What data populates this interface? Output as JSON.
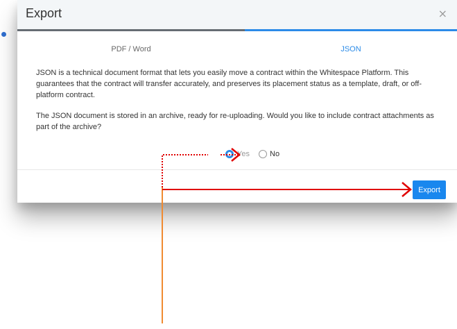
{
  "dialog": {
    "title": "Export",
    "close_glyph": "×"
  },
  "tabs": [
    {
      "label": "PDF / Word",
      "active": false
    },
    {
      "label": "JSON",
      "active": true
    }
  ],
  "body": {
    "paragraph_1": "JSON is a technical document format that lets you easily move a contract within the Whitespace Platform. This guarantees that the contract will transfer accurately, and preserves its placement status as a template, draft, or off-platform contract.",
    "paragraph_2": "The JSON document is stored in an archive, ready for re-uploading. Would you like to include contract attachments as part of the archive?"
  },
  "options": {
    "yes_label": "Yes",
    "no_label": "No",
    "selected": "Yes"
  },
  "footer": {
    "export_label": "Export"
  },
  "colors": {
    "accent": "#2b8be8",
    "button": "#1a87ee",
    "annotation_red": "#e00000",
    "annotation_orange": "#f08a30"
  }
}
